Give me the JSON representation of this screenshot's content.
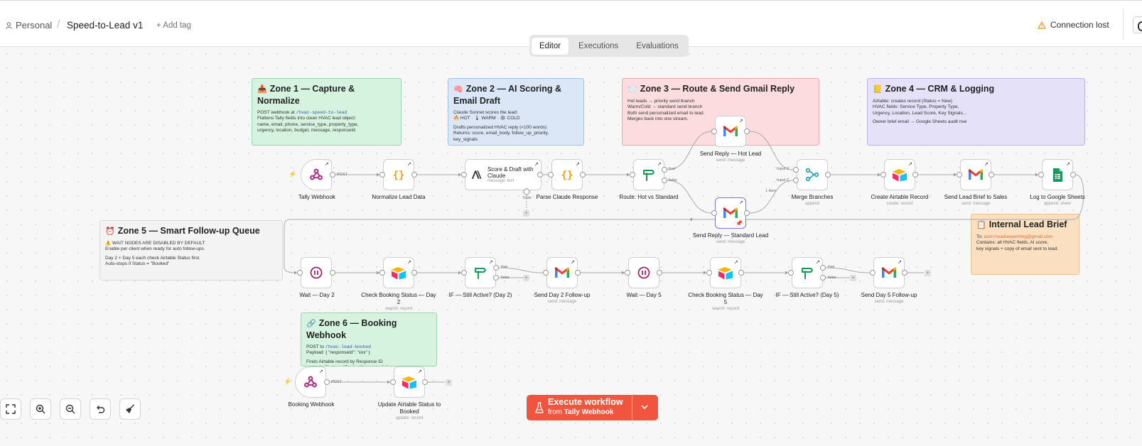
{
  "topbar": {
    "project": "Personal",
    "workflow_name": "Speed-to-Lead v1",
    "add_tag": "+ Add tag",
    "connection_status": "Connection lost"
  },
  "tabs": [
    "Editor",
    "Executions",
    "Evaluations"
  ],
  "notes": {
    "zone1": {
      "emoji": "📥",
      "title": "Zone 1 — Capture & Normalize",
      "line1_prefix": "POST webhook at ",
      "line1_code": "/hvac-speed-to-lead",
      "body": "Flattens Tally fields into clean HVAC lead object:\nname, email, phone, service_type, property_type,\nurgency, location, budget, message, responseId"
    },
    "zone2": {
      "emoji": "🧠",
      "title": "Zone 2 — AI Scoring & Email Draft",
      "body": "Claude Sonnet scores the lead:\n🔥 HOT · 🌡 WARM · ❄ COLD",
      "body2": "Drafts personalized HVAC reply (<100 words)\nReturns: score, email_body, follow_up_priority,\nkey_signals"
    },
    "zone3": {
      "emoji": "📨",
      "title": "Zone 3 — Route & Send Gmail Reply",
      "body": "Hot leads → priority send branch\nWarm/Cold → standard send branch\nBoth send personalized email to lead.\nMerges back into one stream."
    },
    "zone4": {
      "emoji": "📒",
      "title": "Zone 4 — CRM & Logging",
      "body": "Airtable: creates record (Status = New)\nHVAC fields: Service Type, Property Type,\nUrgency, Location, Lead Score, Key Signals...",
      "body2": "Owner brief email → Google Sheets audit row"
    },
    "zone5": {
      "emoji": "⏰",
      "title": "Zone 5 — Smart Follow-up Queue",
      "warn": "⚠️ WAIT NODES ARE DISABLED BY DEFAULT",
      "body": "Enable per client when ready for auto follow-ups.",
      "body2": "Day 2 + Day 5 each check Airtable Status first.\nAuto-stops if Status = \"Booked\""
    },
    "zone6": {
      "emoji": "🔗",
      "title": "Zone 6 — Booking Webhook",
      "line1_prefix": "POST to ",
      "line1_code": "/hvac-lead-booked",
      "body": "Payload: { \"responseId\": \"xxx\" }",
      "body2": "Finds Airtable record by Response ID\nand sets Status = \"Booked\" → stops follow-ups."
    },
    "brief": {
      "emoji": "📋",
      "title": "Internal Lead Brief",
      "to_prefix": "To: ",
      "to_email": "asim.headwaywriting@gmail.com",
      "body": "Contains: all HVAC fields, AI score,\nkey signals + copy of email sent to lead."
    }
  },
  "nodes": {
    "tally_webhook": {
      "label": "Tally Webhook",
      "sub": ""
    },
    "normalize": {
      "label": "Normalize Lead Data",
      "sub": ""
    },
    "score_draft": {
      "label": "Score & Draft with Claude",
      "sub": "message: text"
    },
    "parse_claude": {
      "label": "Parse Claude Response",
      "sub": ""
    },
    "route": {
      "label": "Route: Hot vs Standard",
      "sub": ""
    },
    "send_hot": {
      "label": "Send Reply — Hot Lead",
      "sub": "send: message"
    },
    "send_standard": {
      "label": "Send Reply — Standard Lead",
      "sub": "send: message"
    },
    "merge": {
      "label": "Merge Branches",
      "sub": "append"
    },
    "create_airtable": {
      "label": "Create Airtable Record",
      "sub": "create: record"
    },
    "send_brief": {
      "label": "Send Lead Brief to Sales",
      "sub": "send: message"
    },
    "log_sheets": {
      "label": "Log to Google Sheets",
      "sub": "append: sheet"
    },
    "wait_d2": {
      "label": "Wait — Day 2",
      "sub": ""
    },
    "check_d2": {
      "label": "Check Booking Status — Day 2",
      "sub": "search: record"
    },
    "if_d2": {
      "label": "IF — Still Active? (Day 2)",
      "sub": ""
    },
    "send_d2": {
      "label": "Send Day 2 Follow-up",
      "sub": "send: message"
    },
    "wait_d5": {
      "label": "Wait — Day 5",
      "sub": ""
    },
    "check_d5": {
      "label": "Check Booking Status — Day 5",
      "sub": "search: record"
    },
    "if_d5": {
      "label": "IF — Still Active? (Day 5)",
      "sub": ""
    },
    "send_d5": {
      "label": "Send Day 5 Follow-up",
      "sub": "send: message"
    },
    "booking_webhook": {
      "label": "Booking Webhook",
      "sub": ""
    },
    "update_airtable": {
      "label": "Update Airtable Status to Booked",
      "sub": "update: record"
    }
  },
  "connection_labels": {
    "post1": "POST",
    "true1": "true",
    "false1": "false",
    "tools": "Tools",
    "input1": "Input 1",
    "input2": "Input 2",
    "item": "1 item",
    "true_d2": "true",
    "false_d2": "false",
    "true_d5": "true",
    "false_d5": "false",
    "post2": "POST"
  },
  "execute": {
    "label": "Execute workflow",
    "from_prefix": "from",
    "from_node": "Tally Webhook"
  },
  "colors": {
    "accent": "#f1553d",
    "zone1": "#d5f3df",
    "zone2": "#dbe7f7",
    "zone3": "#fcdcdf",
    "zone4": "#e4e1f8",
    "zone5": "#f3f3f3",
    "zone6": "#d5f3df",
    "brief": "#fae0c0"
  },
  "icons": {
    "user": "user-icon",
    "warning": "warning-triangle-icon",
    "webhook": "webhook-icon",
    "code": "code-braces-icon",
    "anthropic": "anthropic-icon",
    "switch": "switch-icon",
    "gmail": "gmail-icon",
    "merge": "merge-icon",
    "airtable": "airtable-icon",
    "sheets": "google-sheets-icon",
    "wait": "pause-icon",
    "if": "if-icon"
  }
}
